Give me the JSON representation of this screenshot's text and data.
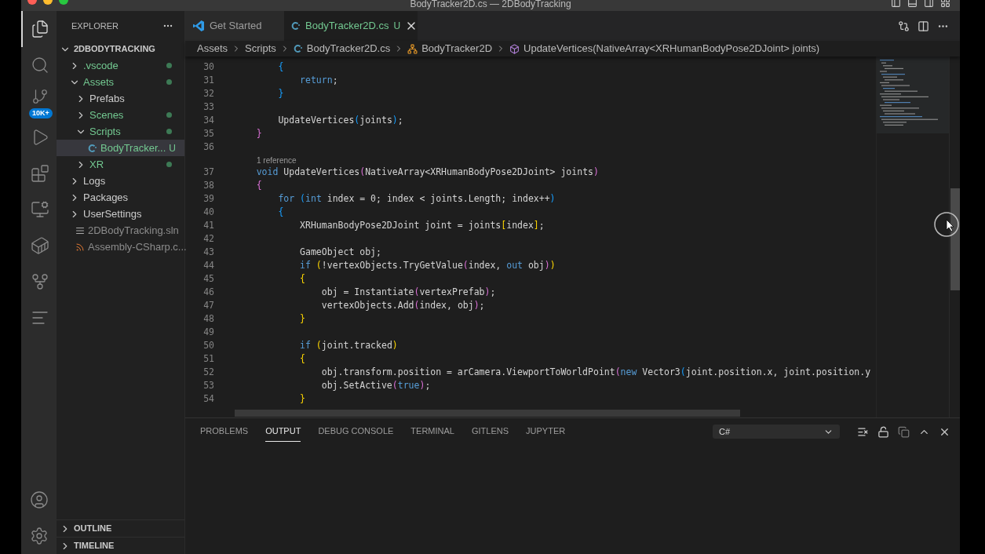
{
  "window": {
    "title": "BodyTracker2D.cs — 2DBodyTracking"
  },
  "activity_bar": {
    "items": [
      {
        "selected": true
      },
      {
        "selected": false
      },
      {
        "selected": false,
        "badge": "10K+"
      },
      {
        "selected": false
      },
      {
        "selected": false
      },
      {
        "selected": false
      },
      {
        "selected": false
      },
      {
        "selected": false
      },
      {
        "selected": false
      }
    ]
  },
  "sidebar": {
    "title": "EXPLORER",
    "root": {
      "label": "2DBODYTRACKING",
      "expanded": true,
      "children": [
        {
          "label": ".vscode",
          "kind": "folder",
          "expanded": false,
          "untracked": true
        },
        {
          "label": "Assets",
          "kind": "folder",
          "expanded": true,
          "untracked": true,
          "children": [
            {
              "label": "Prefabs",
              "kind": "folder",
              "expanded": false,
              "untracked": false
            },
            {
              "label": "Scenes",
              "kind": "folder",
              "expanded": false,
              "untracked": true
            },
            {
              "label": "Scripts",
              "kind": "folder",
              "expanded": true,
              "untracked": true,
              "children": [
                {
                  "label": "BodyTracker...",
                  "kind": "csharp",
                  "untracked": true,
                  "badge": "U",
                  "selected": true
                }
              ]
            },
            {
              "label": "XR",
              "kind": "folder",
              "expanded": false,
              "untracked": true
            }
          ]
        },
        {
          "label": "Logs",
          "kind": "folder",
          "expanded": false,
          "untracked": false
        },
        {
          "label": "Packages",
          "kind": "folder",
          "expanded": false,
          "untracked": false
        },
        {
          "label": "UserSettings",
          "kind": "folder",
          "expanded": false,
          "untracked": false
        },
        {
          "label": "2DBodyTracking.sln",
          "kind": "sln",
          "ignored": true
        },
        {
          "label": "Assembly-CSharp.c...",
          "kind": "feed",
          "ignored": true
        }
      ]
    }
  },
  "sections": [
    {
      "label": "OUTLINE",
      "expanded": false
    },
    {
      "label": "TIMELINE",
      "expanded": false
    }
  ],
  "tabs": [
    {
      "label": "Get Started",
      "kind": "welcome",
      "selected": false
    },
    {
      "label": "BodyTracker2D.cs",
      "kind": "csharp",
      "badge": "U",
      "selected": true
    }
  ],
  "breadcrumbs": [
    {
      "label": "Assets",
      "kind": "folder"
    },
    {
      "label": "Scripts",
      "kind": "folder"
    },
    {
      "label": "BodyTracker2D.cs",
      "kind": "csharp"
    },
    {
      "label": "BodyTracker2D",
      "kind": "class"
    },
    {
      "label": "UpdateVertices(NativeArray<XRHumanBodyPose2DJoint> joints)",
      "kind": "method"
    }
  ],
  "code": [
    {
      "n": "30",
      "tokens": [
        {
          "t": "        {",
          "kind": "b3"
        }
      ]
    },
    {
      "n": "31",
      "tokens": [
        {
          "t": "            return",
          "kind": "kw"
        },
        {
          "t": ";"
        }
      ]
    },
    {
      "n": "32",
      "tokens": [
        {
          "t": "        }",
          "kind": "b3"
        }
      ]
    },
    {
      "n": "33"
    },
    {
      "n": "34",
      "tokens": [
        {
          "t": "        UpdateVertices"
        },
        {
          "t": "(",
          "kind": "b3"
        },
        {
          "t": "joints"
        },
        {
          "t": ")",
          "kind": "b3"
        },
        {
          "t": ";"
        }
      ]
    },
    {
      "n": "35",
      "tokens": [
        {
          "t": "    }",
          "kind": "b2"
        }
      ]
    },
    {
      "n": "36"
    },
    {
      "lens": "1 reference"
    },
    {
      "n": "37",
      "tokens": [
        {
          "t": "    void",
          "kind": "kw"
        },
        {
          "t": " UpdateVertices"
        },
        {
          "t": "(",
          "kind": "b2"
        },
        {
          "t": "NativeArray<XRHumanBodyPose2DJoint> joints"
        },
        {
          "t": ")",
          "kind": "b2"
        }
      ]
    },
    {
      "n": "38",
      "tokens": [
        {
          "t": "    {",
          "kind": "b2"
        }
      ]
    },
    {
      "n": "39",
      "tokens": [
        {
          "t": "        for",
          "kind": "kw"
        },
        {
          "t": " (",
          "kind": "b3"
        },
        {
          "t": "int",
          "kind": "kw"
        },
        {
          "t": " index = 0; index < joints.Length; index++"
        },
        {
          "t": ")",
          "kind": "b3"
        }
      ]
    },
    {
      "n": "40",
      "tokens": [
        {
          "t": "        {",
          "kind": "b3"
        }
      ]
    },
    {
      "n": "41",
      "tokens": [
        {
          "t": "            XRHumanBodyPose2DJoint joint = joints"
        },
        {
          "t": "[",
          "kind": "b1"
        },
        {
          "t": "index"
        },
        {
          "t": "]",
          "kind": "b1"
        },
        {
          "t": ";"
        }
      ]
    },
    {
      "n": "42"
    },
    {
      "n": "43",
      "tokens": [
        {
          "t": "            GameObject obj;"
        }
      ]
    },
    {
      "n": "44",
      "tokens": [
        {
          "t": "            if",
          "kind": "kw"
        },
        {
          "t": " (",
          "kind": "b1"
        },
        {
          "t": "!vertexObjects.TryGetValue"
        },
        {
          "t": "(",
          "kind": "b2"
        },
        {
          "t": "index, "
        },
        {
          "t": "out",
          "kind": "kw"
        },
        {
          "t": " obj"
        },
        {
          "t": ")",
          "kind": "b2"
        },
        {
          "t": ")",
          "kind": "b1"
        }
      ]
    },
    {
      "n": "45",
      "tokens": [
        {
          "t": "            {",
          "kind": "b1"
        }
      ]
    },
    {
      "n": "46",
      "tokens": [
        {
          "t": "                obj = Instantiate"
        },
        {
          "t": "(",
          "kind": "b2"
        },
        {
          "t": "vertexPrefab"
        },
        {
          "t": ")",
          "kind": "b2"
        },
        {
          "t": ";"
        }
      ]
    },
    {
      "n": "47",
      "tokens": [
        {
          "t": "                vertexObjects.Add"
        },
        {
          "t": "(",
          "kind": "b2"
        },
        {
          "t": "index, obj"
        },
        {
          "t": ")",
          "kind": "b2"
        },
        {
          "t": ";"
        }
      ]
    },
    {
      "n": "48",
      "tokens": [
        {
          "t": "            }",
          "kind": "b1"
        }
      ]
    },
    {
      "n": "49"
    },
    {
      "n": "50",
      "tokens": [
        {
          "t": "            if",
          "kind": "kw"
        },
        {
          "t": " (",
          "kind": "b1"
        },
        {
          "t": "joint.tracked"
        },
        {
          "t": ")",
          "kind": "b1"
        }
      ]
    },
    {
      "n": "51",
      "tokens": [
        {
          "t": "            {",
          "kind": "b1"
        }
      ]
    },
    {
      "n": "52",
      "tokens": [
        {
          "t": "                obj.transform.position = arCamera.ViewportToWorldPoint"
        },
        {
          "t": "(",
          "kind": "b2"
        },
        {
          "t": "new",
          "kind": "kw"
        },
        {
          "t": " Vector3"
        },
        {
          "t": "(",
          "kind": "b3"
        },
        {
          "t": "joint.position.x, joint.position.y"
        }
      ]
    },
    {
      "n": "53",
      "tokens": [
        {
          "t": "                obj.SetActive"
        },
        {
          "t": "(",
          "kind": "b2"
        },
        {
          "t": "true",
          "kind": "kw"
        },
        {
          "t": ")",
          "kind": "b2"
        },
        {
          "t": ";"
        }
      ]
    },
    {
      "n": "54",
      "tokens": [
        {
          "t": "            }",
          "kind": "b1"
        }
      ]
    }
  ],
  "panel": {
    "tabs": [
      {
        "label": "PROBLEMS",
        "selected": false
      },
      {
        "label": "OUTPUT",
        "selected": true
      },
      {
        "label": "DEBUG CONSOLE",
        "selected": false
      },
      {
        "label": "TERMINAL",
        "selected": false
      },
      {
        "label": "GITLENS",
        "selected": false
      },
      {
        "label": "JUPYTER",
        "selected": false
      }
    ],
    "channel": "C#"
  }
}
